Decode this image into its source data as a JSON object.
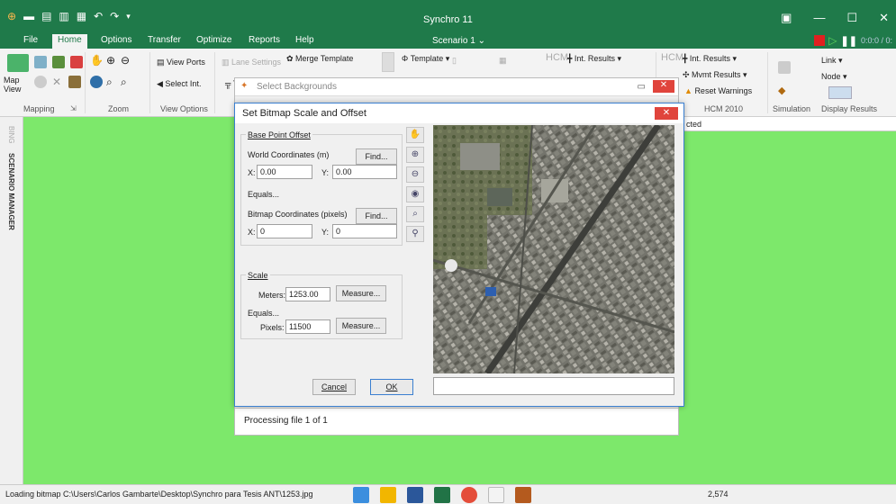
{
  "app": {
    "title": "Synchro 11",
    "scenario": "Scenario 1 ⌄",
    "timecode": "0:0:0 / 0:",
    "win_controls": [
      "▣",
      "—",
      "☐",
      "✕"
    ]
  },
  "tabs": [
    "File",
    "Home",
    "Options",
    "Transfer",
    "Optimize",
    "Reports",
    "Help"
  ],
  "ribbon": {
    "groups": [
      "Mapping",
      "Zoom",
      "View Options",
      "HCM 2010",
      "Simulation",
      "Display Results"
    ],
    "items": {
      "map_view": "Map View",
      "view_ports": "View Ports",
      "select_int": "Select Int.",
      "lane_settings": "Lane Settings",
      "merge_template": "Merge Template",
      "template": "Template ▾",
      "int_results_1": "Int. Results ▾",
      "int_results_2": "Int. Results ▾",
      "mvmt_results": "Mvmt Results ▾",
      "reset_warnings": "Reset Warnings",
      "link": "Link ▾",
      "node": "Node ▾",
      "hcm_1": "HCM",
      "hcm_2": "HCM",
      "te": "Te"
    }
  },
  "side": {
    "bing": "BING",
    "scenario_manager": "SCENARIO MANAGER"
  },
  "bg_dialog": {
    "title": "Select Backgrounds",
    "status": "Processing file 1 of 1",
    "right_pane_text": "cted"
  },
  "dialog": {
    "title": "Set Bitmap Scale and Offset",
    "base_point": {
      "label": "Base Point Offset",
      "world_label": "World Coordinates (m)",
      "find1": "Find...",
      "x_label": "X:",
      "y_label": "Y:",
      "x_world": "0.00",
      "y_world": "0.00",
      "equals": "Equals...",
      "bitmap_label": "Bitmap Coordinates (pixels)",
      "find2": "Find...",
      "x_bitmap": "0",
      "y_bitmap": "0"
    },
    "scale": {
      "label": "Scale",
      "meters_label": "Meters:",
      "meters_value": "1253.00",
      "measure1": "Measure...",
      "equals": "Equals...",
      "pixels_label": "Pixels:",
      "pixels_value": "11500",
      "measure2": "Measure..."
    },
    "cancel": "Cancel",
    "ok": "OK"
  },
  "statusbar": {
    "text": "Loading bitmap C:\\Users\\Carlos Gambarte\\Desktop\\Synchro para Tesis ANT\\1253.jpg",
    "count": "2,574"
  }
}
